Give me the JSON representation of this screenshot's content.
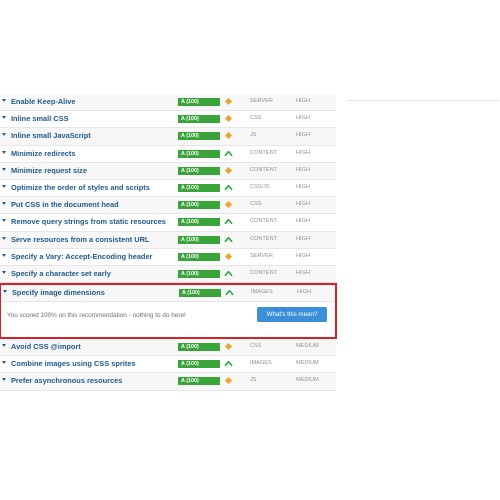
{
  "recommendations": [
    {
      "name": "Enable Keep-Alive",
      "grade": "A (100)",
      "trend": "diamond",
      "type": "SERVER",
      "priority": "HIGH"
    },
    {
      "name": "Inline small CSS",
      "grade": "A (100)",
      "trend": "diamond",
      "type": "CSS",
      "priority": "HIGH"
    },
    {
      "name": "Inline small JavaScript",
      "grade": "A (100)",
      "trend": "diamond",
      "type": "JS",
      "priority": "HIGH"
    },
    {
      "name": "Minimize redirects",
      "grade": "A (100)",
      "trend": "up",
      "type": "CONTENT",
      "priority": "HIGH"
    },
    {
      "name": "Minimize request size",
      "grade": "A (100)",
      "trend": "diamond",
      "type": "CONTENT",
      "priority": "HIGH"
    },
    {
      "name": "Optimize the order of styles and scripts",
      "grade": "A (100)",
      "trend": "up",
      "type": "CSS/JS",
      "priority": "HIGH"
    },
    {
      "name": "Put CSS in the document head",
      "grade": "A (100)",
      "trend": "diamond",
      "type": "CSS",
      "priority": "HIGH"
    },
    {
      "name": "Remove query strings from static resources",
      "grade": "A (100)",
      "trend": "up",
      "type": "CONTENT",
      "priority": "HIGH"
    },
    {
      "name": "Serve resources from a consistent URL",
      "grade": "A (100)",
      "trend": "up",
      "type": "CONTENT",
      "priority": "HIGH"
    },
    {
      "name": "Specify a Vary: Accept-Encoding header",
      "grade": "A (100)",
      "trend": "diamond",
      "type": "SERVER",
      "priority": "HIGH"
    },
    {
      "name": "Specify a character set early",
      "grade": "A (100)",
      "trend": "up",
      "type": "CONTENT",
      "priority": "HIGH"
    }
  ],
  "expanded": {
    "name": "Specify image dimensions",
    "grade": "A (100)",
    "trend": "up",
    "type": "IMAGES",
    "priority": "HIGH",
    "message": "You scored 100% on this recommendation - nothing to do here!",
    "button_label": "What's this mean?"
  },
  "recommendations_after": [
    {
      "name": "Avoid CSS @import",
      "grade": "A (100)",
      "trend": "diamond",
      "type": "CSS",
      "priority": "MEDIUM"
    },
    {
      "name": "Combine images using CSS sprites",
      "grade": "A (100)",
      "trend": "up",
      "type": "IMAGES",
      "priority": "MEDIUM"
    },
    {
      "name": "Prefer asynchronous resources",
      "grade": "A (100)",
      "trend": "diamond",
      "type": "JS",
      "priority": "MEDIUM"
    }
  ],
  "colors": {
    "grade_green": "#3aa33a",
    "trend_up": "#2fa84a",
    "trend_diamond": "#f0a22c",
    "highlight_border": "#d42028",
    "button_blue": "#3a8fd8",
    "link_blue": "#1f5a8c"
  },
  "icons": {
    "caret": "caret-down-icon",
    "up": "trend-up-icon",
    "diamond": "trend-stable-icon"
  }
}
